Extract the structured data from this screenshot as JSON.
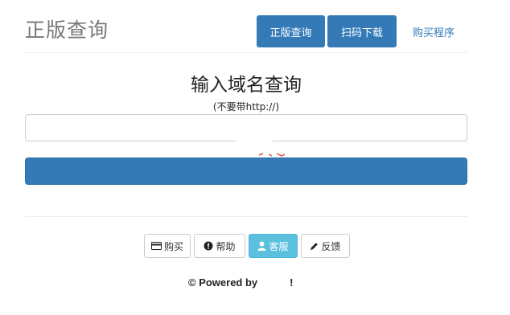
{
  "header": {
    "brand": "正版查询",
    "nav": [
      {
        "label": "正版查询"
      },
      {
        "label": "扫码下载"
      }
    ],
    "link": "购买程序"
  },
  "main": {
    "title": "输入域名查询",
    "hint": "(不要带http://)",
    "input": {
      "value": "",
      "placeholder": ""
    },
    "submit_label": ""
  },
  "footer": {
    "buttons": [
      {
        "label": "购买",
        "icon": "credit-card-icon"
      },
      {
        "label": "帮助",
        "icon": "exclamation-circle-icon"
      },
      {
        "label": "客服",
        "icon": "user-icon"
      },
      {
        "label": "反馈",
        "icon": "pencil-icon"
      }
    ],
    "powered_prefix": "© Powered by",
    "powered_suffix": "!"
  },
  "colors": {
    "primary": "#337ab7",
    "info": "#5bc0de",
    "muted": "#777777"
  }
}
